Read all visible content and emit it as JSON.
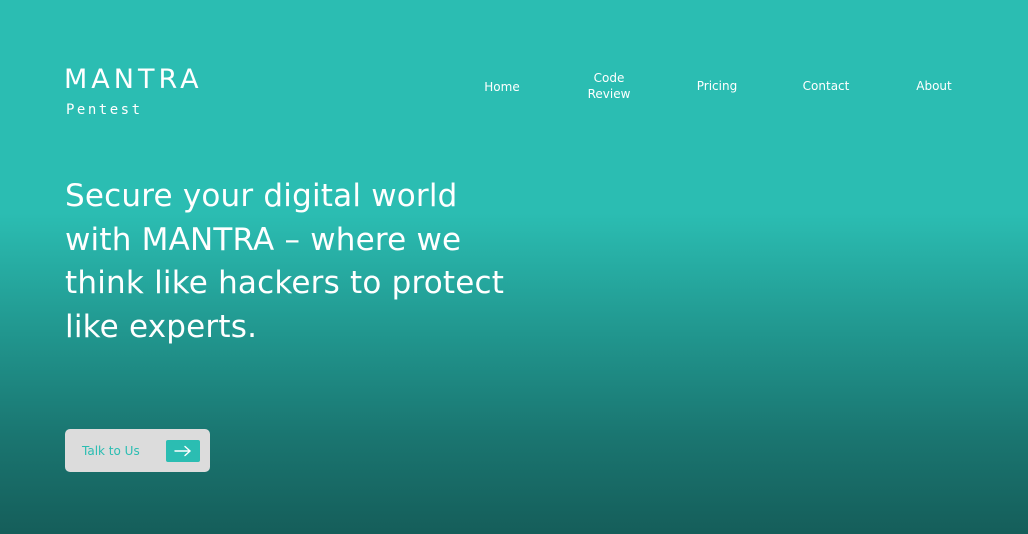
{
  "brand": {
    "name": "MANTRA",
    "tagline": "Pentest"
  },
  "nav": {
    "items": [
      {
        "label": "Home"
      },
      {
        "label": "Code Review"
      },
      {
        "label": "Pricing"
      },
      {
        "label": "Contact"
      },
      {
        "label": "About"
      }
    ]
  },
  "hero": {
    "heading": "Secure your digital world with MANTRA – where we think like hackers to protect like experts.",
    "cta_label": "Talk to Us",
    "cta_icon": "arrow-right-icon"
  },
  "colors": {
    "accent": "#2bbdb2",
    "background_top": "#2bbdb2",
    "background_bottom": "#155e5a",
    "button_bg": "#dcdcdc",
    "text": "#ffffff"
  }
}
